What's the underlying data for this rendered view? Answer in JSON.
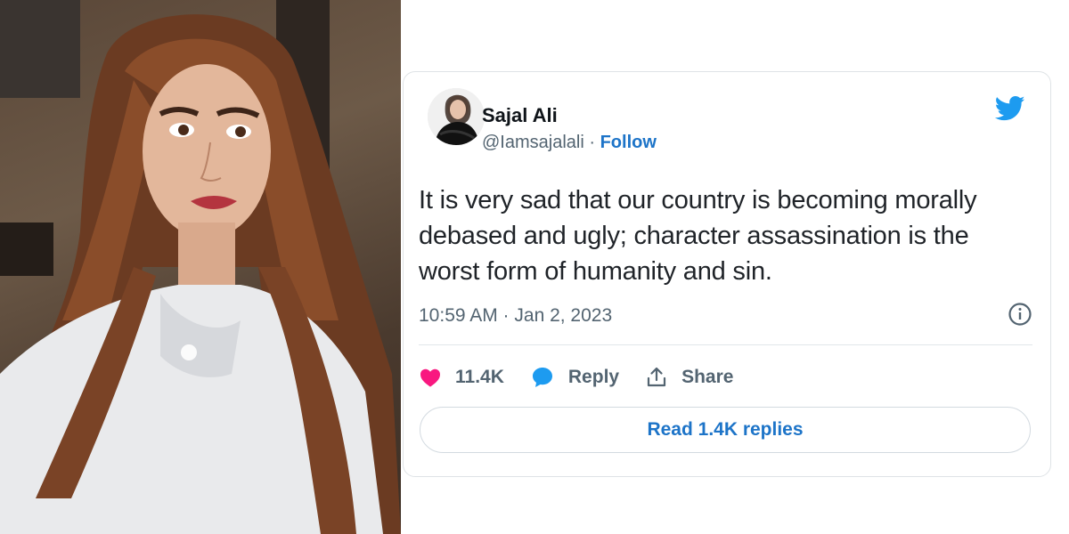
{
  "tweet": {
    "author_name": "Sajal Ali",
    "handle": "@Iamsajalali",
    "separator": " · ",
    "follow_label": "Follow",
    "text": "It is very sad that our country is becoming morally debased and ugly; character assassination is the worst form of humanity and sin.",
    "timestamp": "10:59 AM · Jan 2, 2023",
    "likes": "11.4K",
    "reply_label": "Reply",
    "share_label": "Share",
    "read_replies_label": "Read 1.4K replies"
  },
  "icons": {
    "brand": "twitter-bird-icon",
    "info": "info-icon",
    "like": "heart-icon",
    "reply": "speech-bubble-icon",
    "share": "share-upload-icon"
  },
  "colors": {
    "accent_blue": "#1d9bf0",
    "link_blue": "#1d74c8",
    "heart_pink": "#f91880",
    "text_dark": "#0f1419",
    "text_gray": "#536471"
  }
}
